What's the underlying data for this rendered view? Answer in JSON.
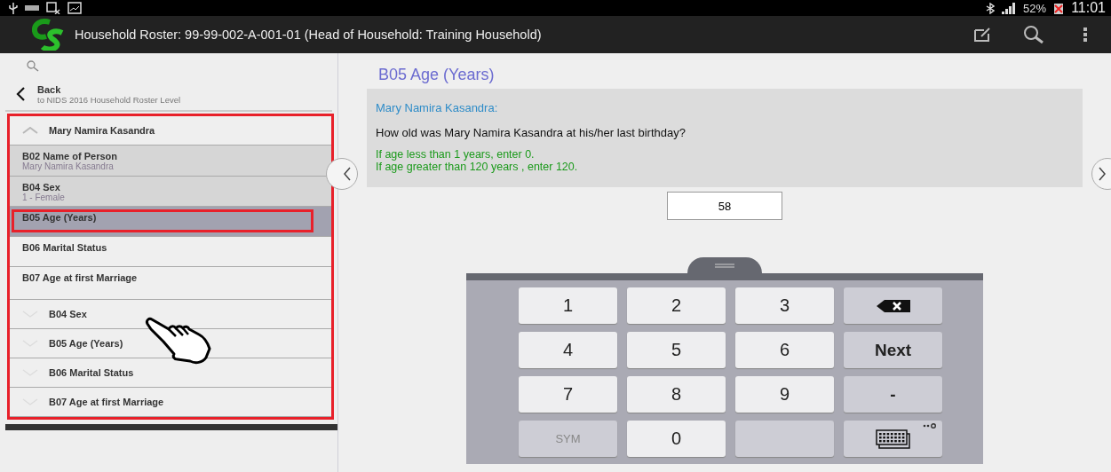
{
  "status_bar": {
    "battery": "52%",
    "time": "11:01"
  },
  "app_bar": {
    "title": "Household Roster: 99-99-002-A-001-01 (Head of Household: Training Household)"
  },
  "sidebar": {
    "back": {
      "label": "Back",
      "sublabel": "to NIDS 2016 Household Roster Level"
    },
    "items": [
      {
        "kind": "group",
        "label": "Mary Namira Kasandra",
        "expanded": true
      },
      {
        "kind": "question",
        "label": "B02 Name of Person",
        "value": "Mary Namira Kasandra",
        "answered": true,
        "selected": false,
        "outlined": false
      },
      {
        "kind": "question",
        "label": "B04 Sex",
        "value": "1 - Female",
        "answered": true,
        "selected": false,
        "outlined": false
      },
      {
        "kind": "question",
        "label": "B05 Age (Years)",
        "selected": true,
        "outlined": true
      },
      {
        "kind": "question",
        "label": "B06 Marital Status",
        "answered": false,
        "selected": false,
        "outlined": false
      },
      {
        "kind": "question",
        "label": "B07 Age at first Marriage",
        "answered": false,
        "selected": false,
        "outlined": false
      },
      {
        "kind": "group",
        "label": "B04 Sex",
        "expanded": false
      },
      {
        "kind": "group",
        "label": "B05 Age (Years)",
        "expanded": false
      },
      {
        "kind": "group",
        "label": "B06 Marital Status",
        "expanded": false
      },
      {
        "kind": "group",
        "label": "B07 Age at first Marriage",
        "expanded": false
      }
    ]
  },
  "question": {
    "title": "B05 Age (Years)",
    "person": "Mary Namira Kasandra:",
    "text": "How old was Mary Namira Kasandra at his/her last birthday?",
    "hints": [
      "If age less than 1 years, enter 0.",
      "If age greater than 120 years , enter 120."
    ],
    "answer": "58"
  },
  "keyboard": {
    "keys": [
      {
        "kind": "digit",
        "label": "1"
      },
      {
        "kind": "digit",
        "label": "2"
      },
      {
        "kind": "digit",
        "label": "3"
      },
      {
        "kind": "backspace"
      },
      {
        "kind": "digit",
        "label": "4"
      },
      {
        "kind": "digit",
        "label": "5"
      },
      {
        "kind": "digit",
        "label": "6"
      },
      {
        "kind": "action",
        "label": "Next"
      },
      {
        "kind": "digit",
        "label": "7"
      },
      {
        "kind": "digit",
        "label": "8"
      },
      {
        "kind": "digit",
        "label": "9"
      },
      {
        "kind": "action",
        "label": "-"
      },
      {
        "kind": "symbol",
        "label": "SYM"
      },
      {
        "kind": "digit",
        "label": "0"
      },
      {
        "kind": "blank"
      },
      {
        "kind": "switch"
      }
    ]
  }
}
